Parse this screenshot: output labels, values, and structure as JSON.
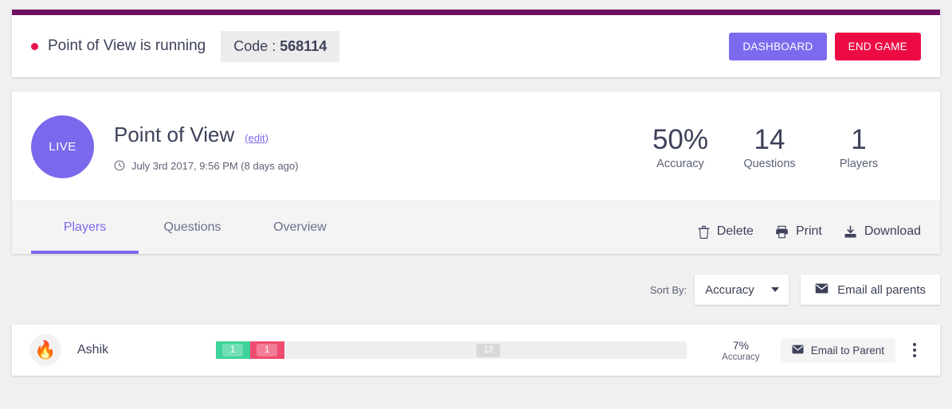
{
  "status_bar": {
    "accent_color": "#6d1163",
    "dot_color": "#e8134b",
    "running_text": "Point of View is running",
    "code_label": "Code : ",
    "code_value": "568114",
    "dashboard_label": "DASHBOARD",
    "end_game_label": "END GAME"
  },
  "summary": {
    "live_badge": "LIVE",
    "title": "Point of View",
    "edit_link": "(edit)",
    "date": "July 3rd 2017, 9:56 PM (8 days ago)",
    "stats": [
      {
        "value": "50%",
        "label": "Accuracy"
      },
      {
        "value": "14",
        "label": "Questions"
      },
      {
        "value": "1",
        "label": "Players"
      }
    ]
  },
  "tabs": [
    {
      "label": "Players",
      "active": true
    },
    {
      "label": "Questions",
      "active": false
    },
    {
      "label": "Overview",
      "active": false
    }
  ],
  "tools": [
    {
      "label": "Delete",
      "icon": "trash-icon"
    },
    {
      "label": "Print",
      "icon": "printer-icon"
    },
    {
      "label": "Download",
      "icon": "download-icon"
    }
  ],
  "controls": {
    "sort_by_label": "Sort By:",
    "sort_by_value": "Accuracy",
    "email_all_label": "Email all parents"
  },
  "players": [
    {
      "avatar": "🔥",
      "name": "Ashik",
      "correct": "1",
      "incorrect": "1",
      "unanswered": "12",
      "accuracy_value": "7%",
      "accuracy_label": "Accuracy",
      "email_label": "Email to Parent"
    }
  ],
  "colors": {
    "brand_purple": "#7a69ec",
    "danger_red": "#ec0b43",
    "correct_green": "#3fd39a",
    "incorrect_pink": "#ef4b6e",
    "neutral_gray": "#d8d8d8"
  }
}
